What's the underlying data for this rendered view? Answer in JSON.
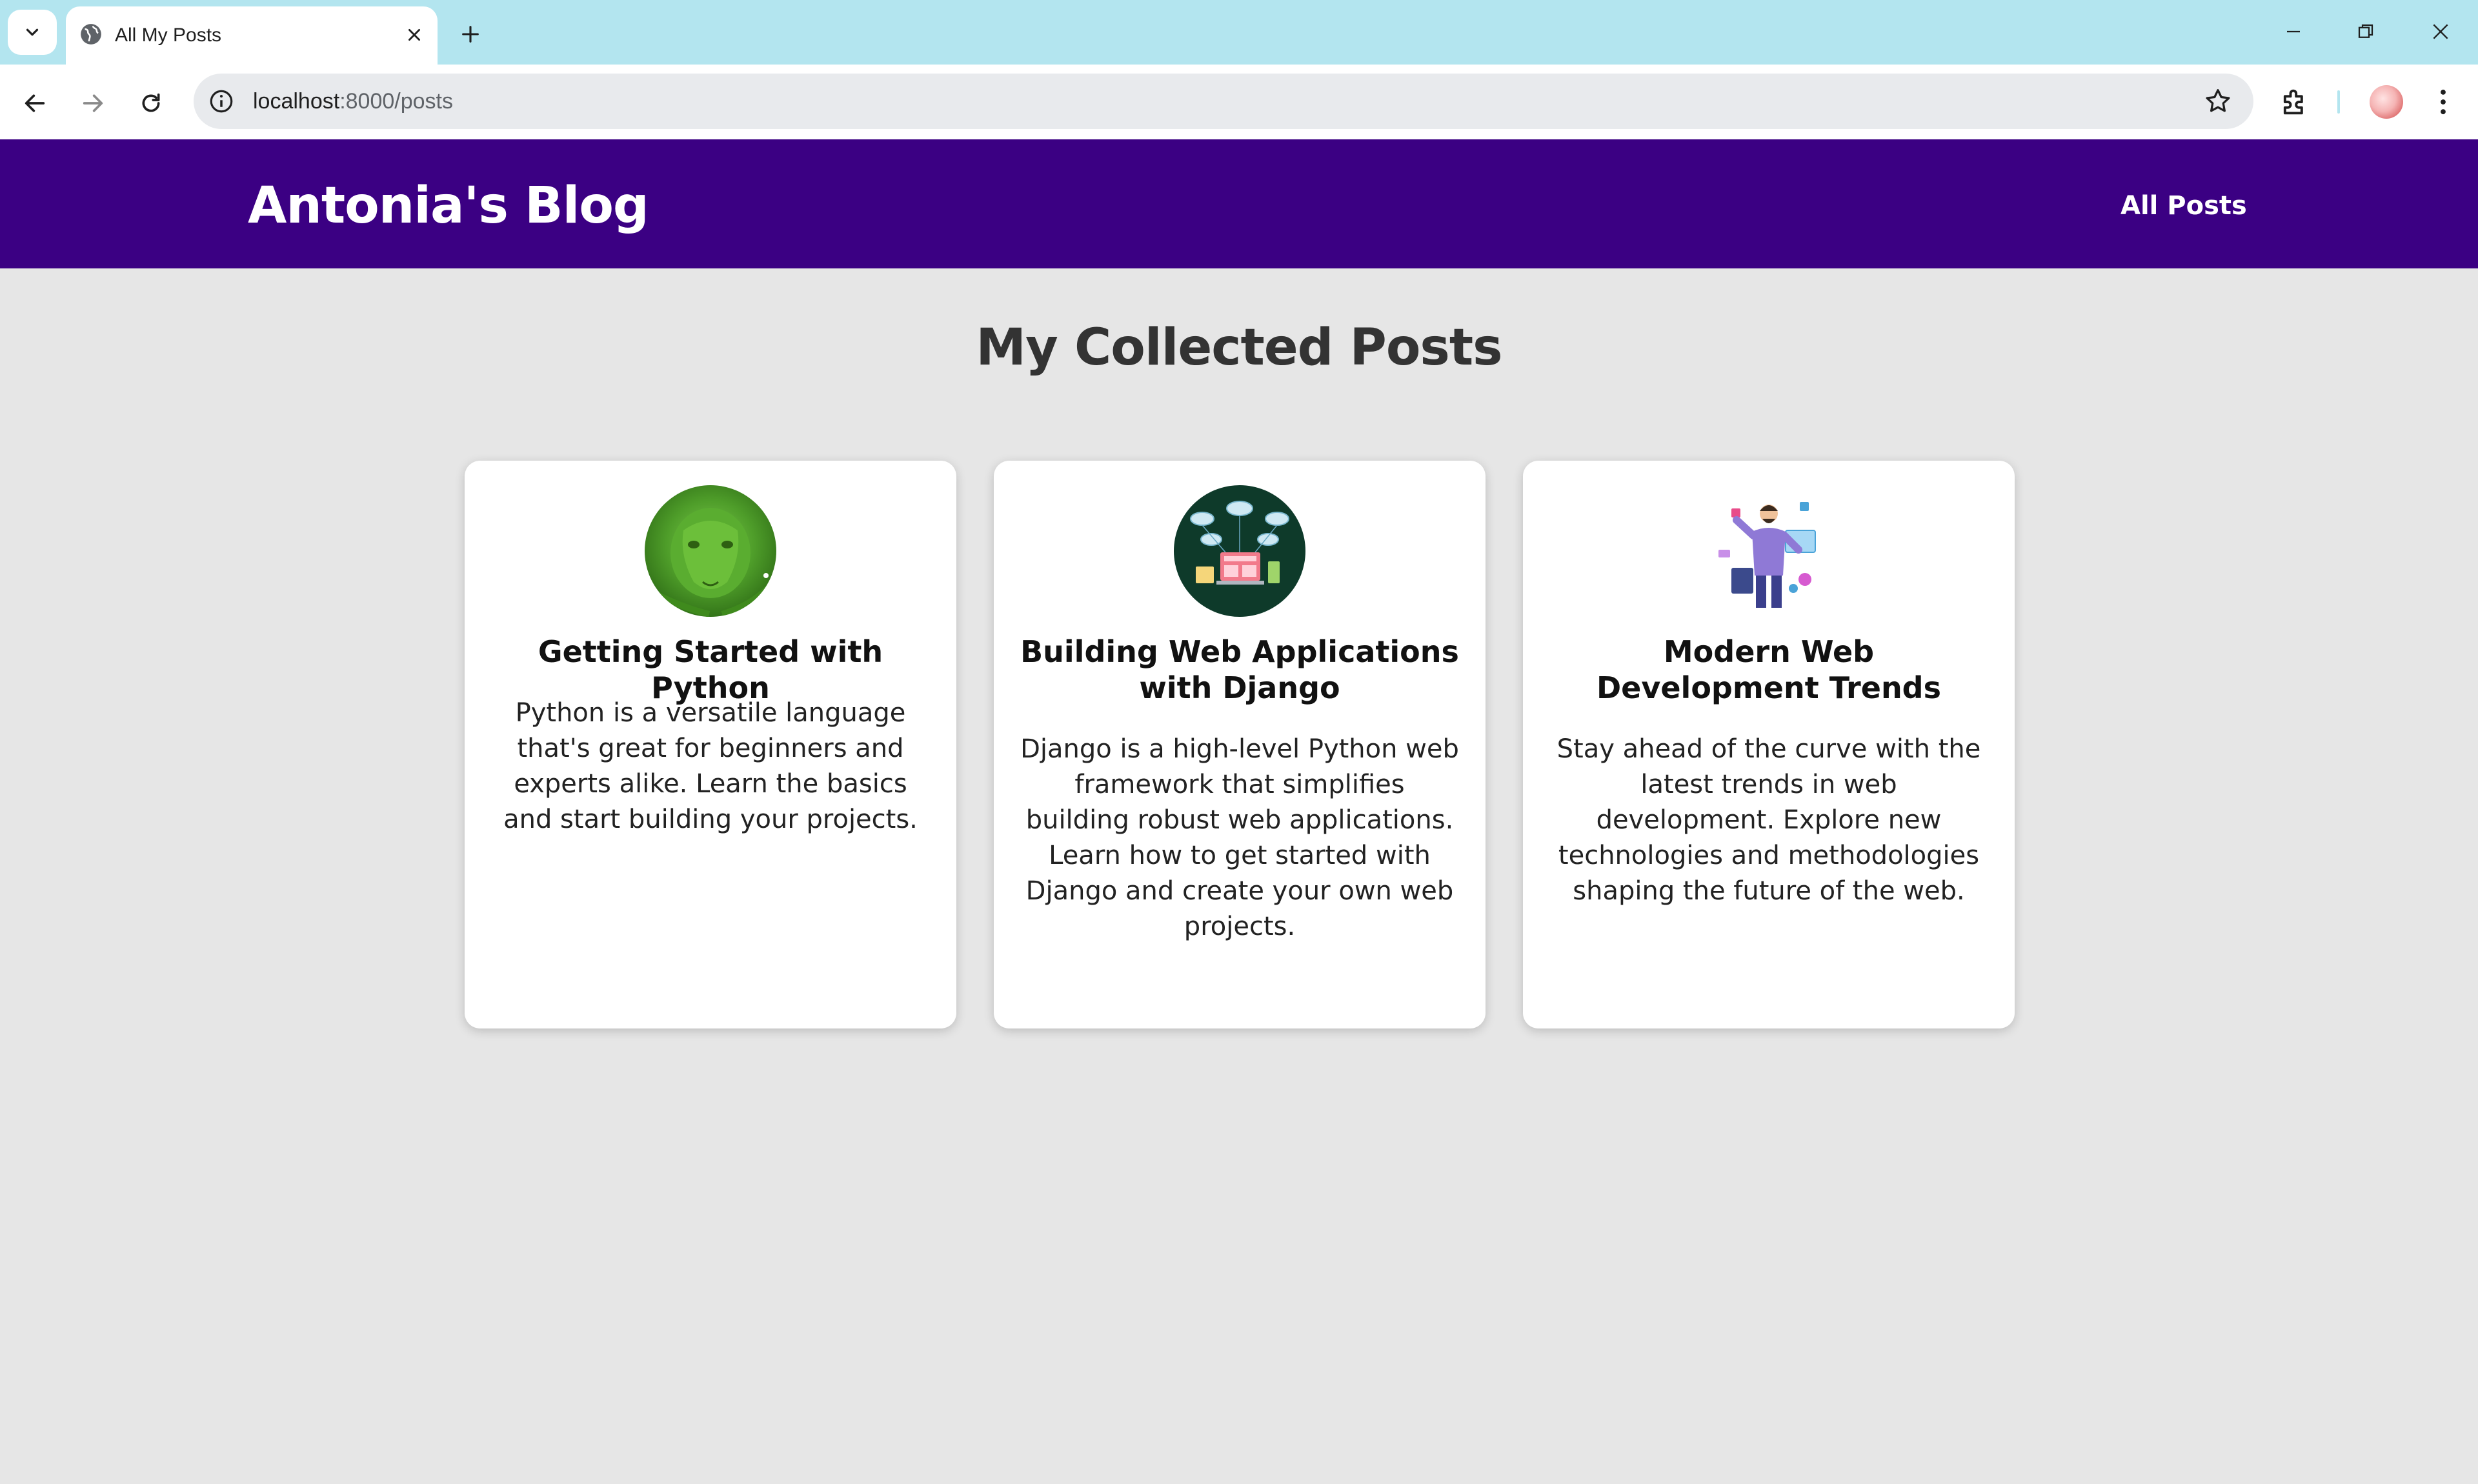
{
  "browser": {
    "tab_title": "All My Posts",
    "url_host": "localhost",
    "url_path": ":8000/posts"
  },
  "site": {
    "title": "Antonia's Blog",
    "nav": [
      {
        "label": "All Posts"
      }
    ]
  },
  "main": {
    "heading": "My Collected Posts",
    "posts": [
      {
        "title": "Getting Started with Python",
        "excerpt": "Python is a versatile language that's great for beginners and experts alike. Learn the basics and start building your projects.",
        "image": "green-snake-image"
      },
      {
        "title": "Building Web Applications with Django",
        "excerpt": "Django is a high-level Python web framework that simplifies building robust web applications. Learn how to get started with Django and create your own web projects.",
        "image": "web-cloud-laptop-image"
      },
      {
        "title": "Modern Web Development Trends",
        "excerpt": "Stay ahead of the curve with the latest trends in web development. Explore new technologies and methodologies shaping the future of the web.",
        "image": "developer-illustration-image"
      }
    ]
  },
  "colors": {
    "header_bg": "#3b0083",
    "page_bg": "#e6e6e6",
    "tabbar_bg": "#b3e5ef"
  }
}
